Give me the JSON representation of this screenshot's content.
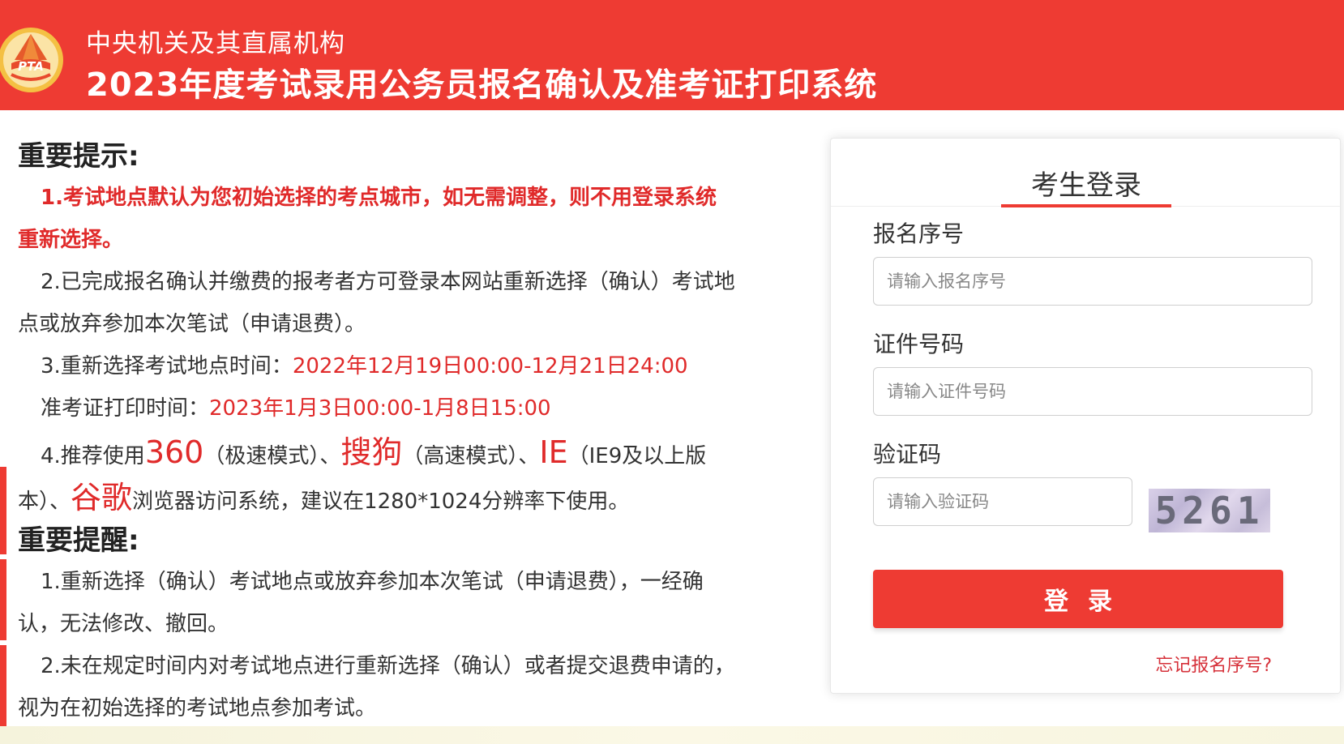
{
  "header": {
    "logo_text": "PTA",
    "sub_title": "中央机关及其直属机构",
    "main_title": "2023年度考试录用公务员报名确认及准考证打印系统"
  },
  "notice": {
    "important_tips_title": "重要提示:",
    "tip1_line1": "1.考试地点默认为您初始选择的考点城市，如无需调整，则不用登录系统",
    "tip1_line2": "重新选择。",
    "tip2_line1": "2.已完成报名确认并缴费的报考者方可登录本网站重新选择（确认）考试地",
    "tip2_line2": "点或放弃参加本次笔试（申请退费）。",
    "tip3_label": "3.重新选择考试地点时间：",
    "tip3_time": "2022年12月19日00:00-12月21日24:00",
    "tip3b_label": "准考证打印时间：",
    "tip3b_time": "2023年1月3日00:00-1月8日15:00",
    "tip4_prefix": "4.推荐使用",
    "tip4_b1": "360",
    "tip4_t1": "（极速模式）、",
    "tip4_b2": "搜狗",
    "tip4_t2": "（高速模式）、",
    "tip4_b3": "IE",
    "tip4_t3": "（IE9及以上版",
    "tip4_l2_prefix": "本）、",
    "tip4_b4": "谷歌",
    "tip4_l2_suffix": "浏览器访问系统，建议在1280*1024分辨率下使用。",
    "reminder_title": "重要提醒:",
    "rem1_line1": "1.重新选择（确认）考试地点或放弃参加本次笔试（申请退费），一经确",
    "rem1_line2": "认，无法修改、撤回。",
    "rem2_line1": "2.未在规定时间内对考试地点进行重新选择（确认）或者提交退费申请的，",
    "rem2_line2": "视为在初始选择的考试地点参加考试。"
  },
  "login": {
    "title": "考生登录",
    "reg_label": "报名序号",
    "reg_placeholder": "请输入报名序号",
    "id_label": "证件号码",
    "id_placeholder": "请输入证件号码",
    "captcha_label": "验证码",
    "captcha_placeholder": "请输入验证码",
    "captcha_code": "5261",
    "login_button": "登录",
    "forgot_link": "忘记报名序号?"
  },
  "colors": {
    "brand_red": "#ee3b33",
    "link_red": "#d6313a",
    "highlight_red": "#e02a2a"
  }
}
